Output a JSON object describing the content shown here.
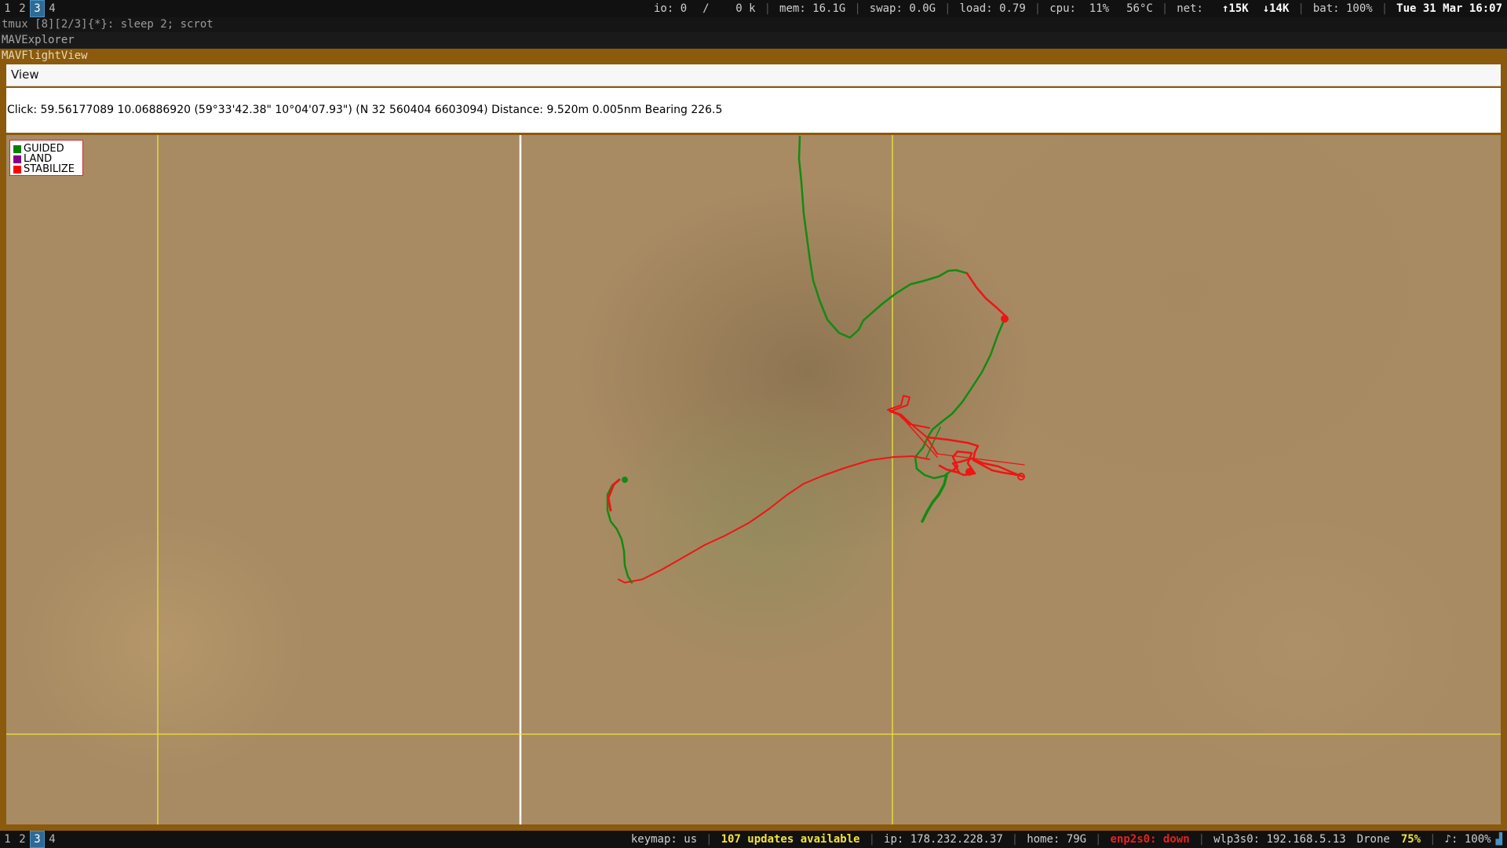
{
  "top_bar": {
    "workspaces": [
      "1",
      "2",
      "3",
      "4"
    ],
    "active_workspace": "3",
    "io": "io: 0",
    "io_rate": "/    0 k",
    "mem": "mem: 16.1G",
    "swap": "swap: 0.0G",
    "load": "load: 0.79",
    "cpu": "cpu:  11%",
    "temp": "56°C",
    "net_label": "net:",
    "net_up": "↑15K",
    "net_down": "↓14K",
    "bat": "bat: 100%",
    "datetime": "Tue 31 Mar 16:07"
  },
  "tmux_line": "tmux [8][2/3]{*}:  sleep 2; scrot",
  "explorer_title": "MAVExplorer",
  "flight_view": {
    "title": "MAVFlightView",
    "menu": [
      "View"
    ],
    "click_info": "Click: 59.56177089 10.06886920 (59°33'42.38\" 10°04'07.93\") (N 32 560404 6603094)  Distance: 9.520m 0.005nm Bearing 226.5"
  },
  "legend": [
    {
      "label": "GUIDED",
      "color": "#008000"
    },
    {
      "label": "LAND",
      "color": "#800080"
    },
    {
      "label": "STABILIZE",
      "color": "#ff0000"
    }
  ],
  "bottom_bar": {
    "workspaces": [
      "1",
      "2",
      "3",
      "4"
    ],
    "active_workspace": "3",
    "keymap": "keymap: us",
    "updates": "107 updates available",
    "ip": "ip: 178.232.228.37",
    "home": "home: 79G",
    "enp": "enp2s0: down",
    "wlp": "wlp3s0: 192.168.5.13",
    "drone_label": "Drone",
    "drone_pct": "75%",
    "volume": "♪: 100%"
  },
  "colors": {
    "guided_track": "#138a13",
    "stabilize_track": "#ee1515",
    "grid_yellow": "#f2e23a",
    "window_border": "#8b5a0c"
  }
}
